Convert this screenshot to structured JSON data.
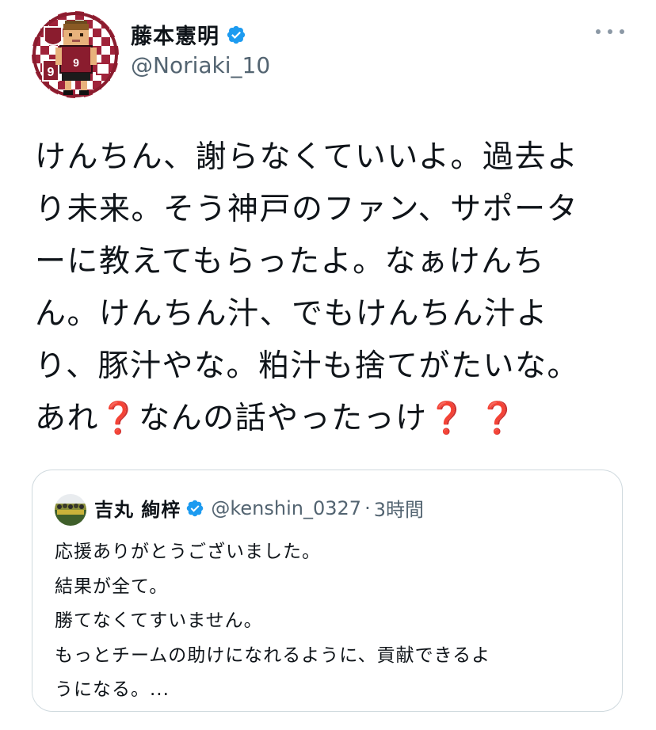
{
  "author": {
    "display_name": "藤本憲明",
    "handle": "@Noriaki_10",
    "avatar_icon": "pixel-art-player-avatar",
    "verified_icon": "verified-badge-icon"
  },
  "more_icon": "more-options-icon",
  "tweet": {
    "lines": [
      "けんちん、謝らなくていいよ。過去よ",
      "り未来。そう神戸のファン、サポータ",
      "ーに教えてもらったよ。なぁけんち",
      "ん。けんちん汁、でもけんちん汁よ",
      "り、豚汁やな。粕汁も捨てがたいな。"
    ],
    "last_line": {
      "part1": "あれ",
      "emoji1": "❓",
      "part2": "なんの話やったっけ",
      "emoji2": "❓",
      "emoji3": "❓"
    }
  },
  "quote": {
    "display_name": "吉丸 絢梓",
    "handle": "@kenshin_0327",
    "separator": "·",
    "time": "3時間",
    "avatar_icon": "team-photo-avatar",
    "lines": [
      "応援ありがとうございました。",
      "結果が全て。",
      "勝てなくてすいません。",
      "もっとチームの助けになれるように、貢献できるよ",
      "うになる。..."
    ]
  },
  "colors": {
    "verified": "#1d9bf0",
    "text": "#0f1419",
    "secondary": "#536471",
    "border": "#cfd9de",
    "emoji_red": "#c8102e"
  }
}
